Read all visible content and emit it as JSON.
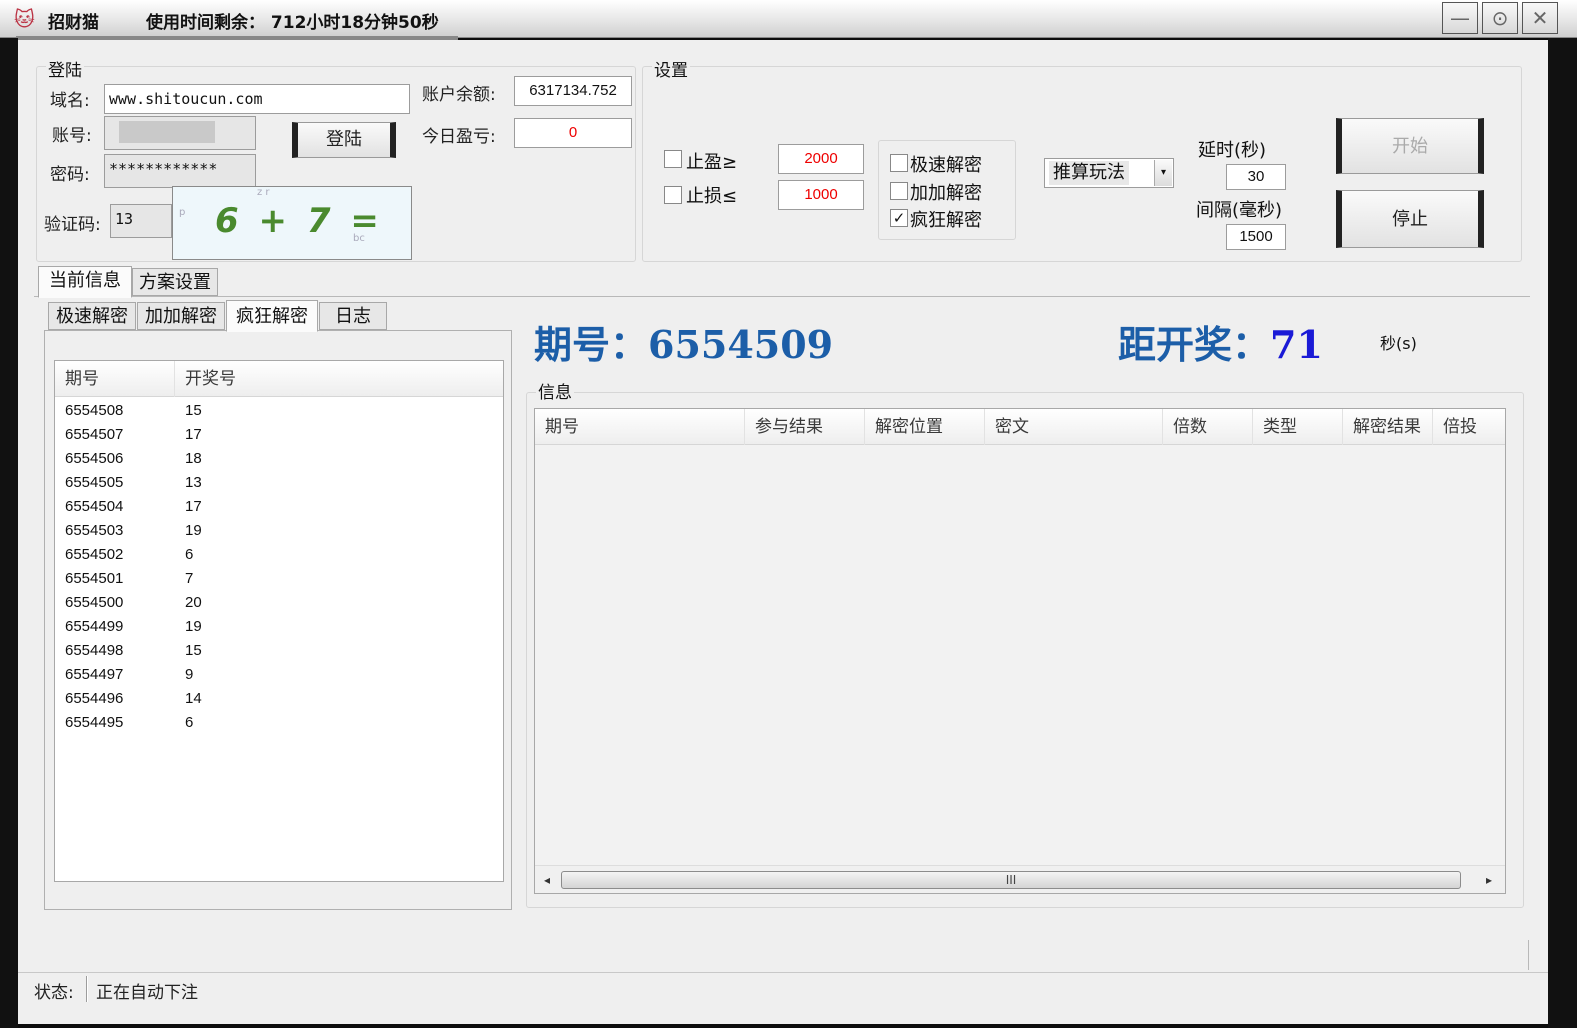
{
  "window": {
    "app_icon": "cat-icon",
    "title": "招财猫",
    "time_left": "使用时间剩余：  712小时18分钟50秒",
    "min_glyph": "—",
    "restore_glyph": "⊙",
    "close_glyph": "✕"
  },
  "login": {
    "group_title": "登陆",
    "domain_label": "域名:",
    "domain_value": "www.shitoucun.com",
    "account_label": "账号:",
    "password_label": "密码:",
    "password_value": "************",
    "captcha_label": "验证码:",
    "captcha_value": "13",
    "captcha_image_text": "6 + 7 =",
    "login_button": "登陆",
    "balance_label": "账户余额:",
    "balance_value": "6317134.752",
    "today_pl_label": "今日盈亏:",
    "today_pl_value": "0"
  },
  "settings": {
    "group_title": "设置",
    "take_profit_label": "止盈≥",
    "take_profit_value": "2000",
    "take_profit_checked": false,
    "stop_loss_label": "止损≤",
    "stop_loss_value": "1000",
    "stop_loss_checked": false,
    "modes": [
      {
        "label": "极速解密",
        "checked": false
      },
      {
        "label": "加加解密",
        "checked": false
      },
      {
        "label": "疯狂解密",
        "checked": true
      }
    ],
    "play_select_value": "推算玩法",
    "delay_label": "延时(秒)",
    "delay_value": "30",
    "interval_label": "间隔(毫秒)",
    "interval_value": "1500",
    "start_button": "开始",
    "stop_button": "停止",
    "check_mark": "✓"
  },
  "main_tabs": [
    "当前信息",
    "方案设置"
  ],
  "sub_tabs": [
    "极速解密",
    "加加解密",
    "疯狂解密",
    "日志"
  ],
  "history": {
    "columns": [
      "期号",
      "开奖号"
    ],
    "rows": [
      [
        "6554508",
        "15"
      ],
      [
        "6554507",
        "17"
      ],
      [
        "6554506",
        "18"
      ],
      [
        "6554505",
        "13"
      ],
      [
        "6554504",
        "17"
      ],
      [
        "6554503",
        "19"
      ],
      [
        "6554502",
        "6"
      ],
      [
        "6554501",
        "7"
      ],
      [
        "6554500",
        "20"
      ],
      [
        "6554499",
        "19"
      ],
      [
        "6554498",
        "15"
      ],
      [
        "6554497",
        "9"
      ],
      [
        "6554496",
        "14"
      ],
      [
        "6554495",
        "6"
      ]
    ]
  },
  "current": {
    "issue_label": "期号：",
    "issue_value": "6554509",
    "countdown_label": "距开奖：",
    "countdown_value": "71",
    "seconds_unit": "秒(s)"
  },
  "info": {
    "group_title": "信息",
    "columns": [
      "期号",
      "参与结果",
      "解密位置",
      "密文",
      "倍数",
      "类型",
      "解密结果",
      "倍投"
    ],
    "scroll_left": "◂",
    "scroll_right": "▸",
    "scroll_grip": "III"
  },
  "status": {
    "label": "状态:",
    "value": "正在自动下注"
  }
}
